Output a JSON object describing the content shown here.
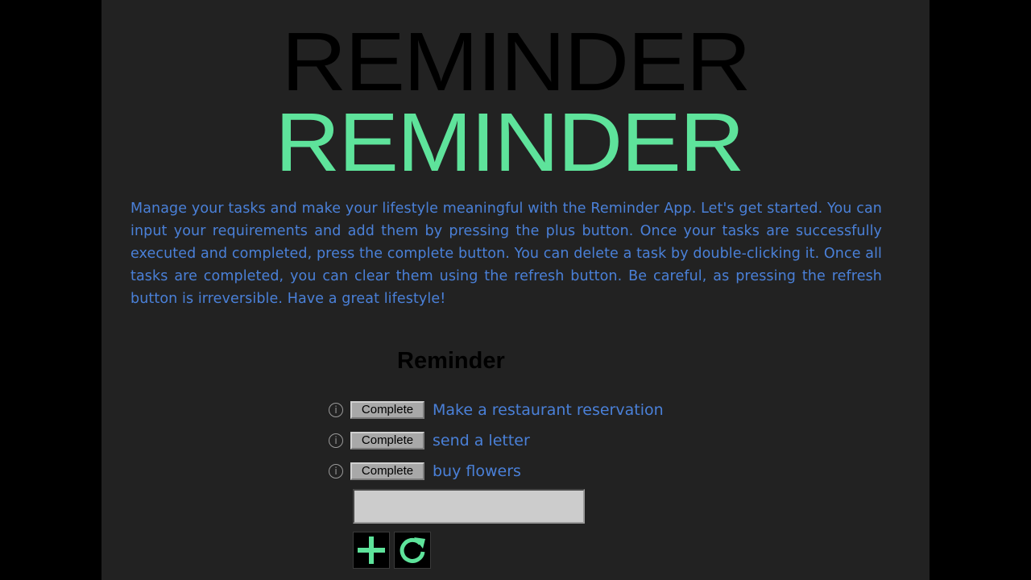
{
  "header": {
    "title_shadow": "REMINDER",
    "title": "REMINDER"
  },
  "intro": {
    "description": "Manage your tasks and make your lifestyle meaningful with the Reminder App. Let's get started. You can input your requirements and add them by pressing the plus button. Once your tasks are successfully executed and completed, press the complete button. You can delete a task by double-clicking it. Once all tasks are completed, you can clear them using the refresh button. Be careful, as pressing the refresh button is irreversible. Have a great lifestyle!"
  },
  "reminder": {
    "heading": "Reminder",
    "tasks": [
      {
        "info_icon": "info-icon",
        "complete_label": "Complete",
        "text": "Make a restaurant reservation"
      },
      {
        "info_icon": "info-icon",
        "complete_label": "Complete",
        "text": "send a letter"
      },
      {
        "info_icon": "info-icon",
        "complete_label": "Complete",
        "text": "buy flowers"
      }
    ],
    "input": {
      "value": "",
      "placeholder": ""
    },
    "add_icon": "plus-icon",
    "refresh_icon": "refresh-icon"
  },
  "colors": {
    "background": "#000000",
    "panel": "#222222",
    "accent_green": "#5ee39b",
    "text_blue": "#4a80d8",
    "title_shadow": "#000000"
  }
}
